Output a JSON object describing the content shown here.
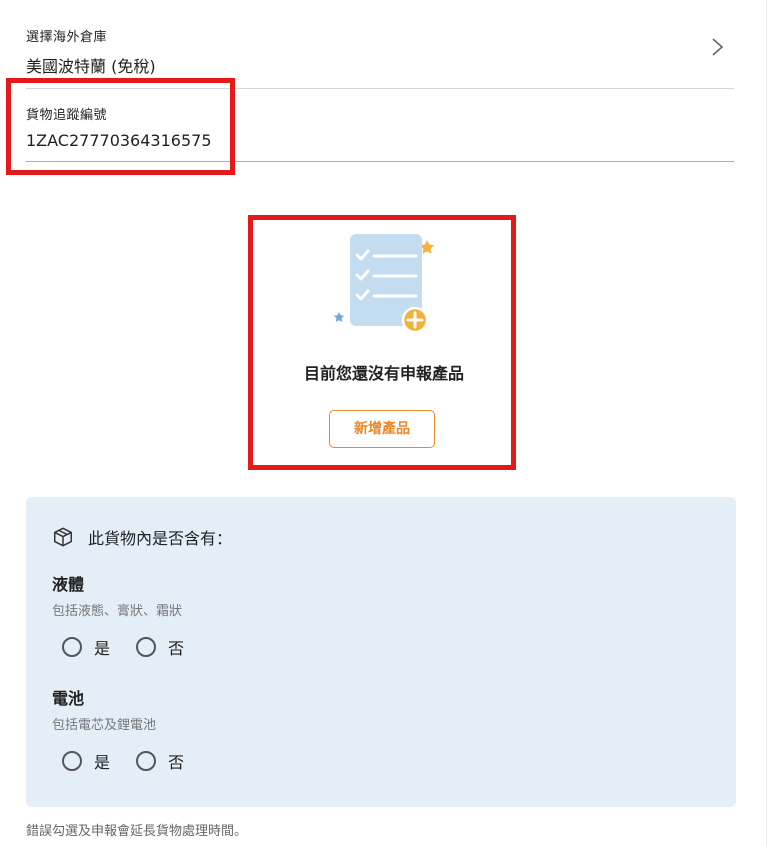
{
  "warehouse": {
    "label": "選擇海外倉庫",
    "value": "美國波特蘭 (免稅)",
    "chevron_icon": "chevron-right-icon"
  },
  "tracking": {
    "label": "貨物追蹤編號",
    "value": "1ZAC27770364316575"
  },
  "products": {
    "empty_icon": "checklist-add-icon",
    "empty_text": "目前您還沒有申報產品",
    "add_button": "新增產品"
  },
  "contents": {
    "icon": "package-icon",
    "heading": "此貨物內是否含有：",
    "questions": [
      {
        "title": "液體",
        "hint": "包括液態、膏狀、霜狀",
        "yes": "是",
        "no": "否"
      },
      {
        "title": "電池",
        "hint": "包括電芯及鋰電池",
        "yes": "是",
        "no": "否"
      }
    ]
  },
  "footnote": "錯誤勾選及申報會延長貨物處理時間。",
  "colors": {
    "accent": "#e8892a",
    "highlight": "#e4191a",
    "panel_bg": "#e3eef7",
    "input_underline": "#e3a93a",
    "doc_blue": "#c3dcf0"
  }
}
